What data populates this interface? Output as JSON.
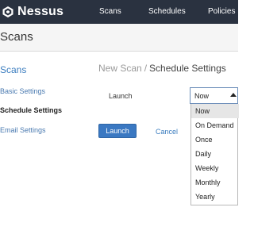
{
  "app": {
    "name": "Nessus",
    "logo_icon": "nessus-logo-icon"
  },
  "nav": {
    "items": [
      {
        "label": "Scans"
      },
      {
        "label": "Schedules"
      },
      {
        "label": "Policies"
      }
    ]
  },
  "page": {
    "title": "Scans"
  },
  "sidebar": {
    "title": "Scans",
    "items": [
      {
        "label": "Basic Settings",
        "active": false
      },
      {
        "label": "Schedule Settings",
        "active": true
      },
      {
        "label": "Email Settings",
        "active": false
      }
    ]
  },
  "breadcrumb": {
    "parent": "New Scan",
    "separator": "/",
    "current": "Schedule Settings"
  },
  "form": {
    "launch_label": "Launch",
    "launch_select": {
      "value": "Now",
      "options": [
        "Now",
        "On Demand",
        "Once",
        "Daily",
        "Weekly",
        "Monthly",
        "Yearly"
      ],
      "highlighted": "Now"
    }
  },
  "actions": {
    "launch_label": "Launch",
    "cancel_label": "Cancel"
  },
  "colors": {
    "topbar_bg": "#2a3240",
    "accent": "#3a78c2",
    "link": "#3b7dbf"
  }
}
